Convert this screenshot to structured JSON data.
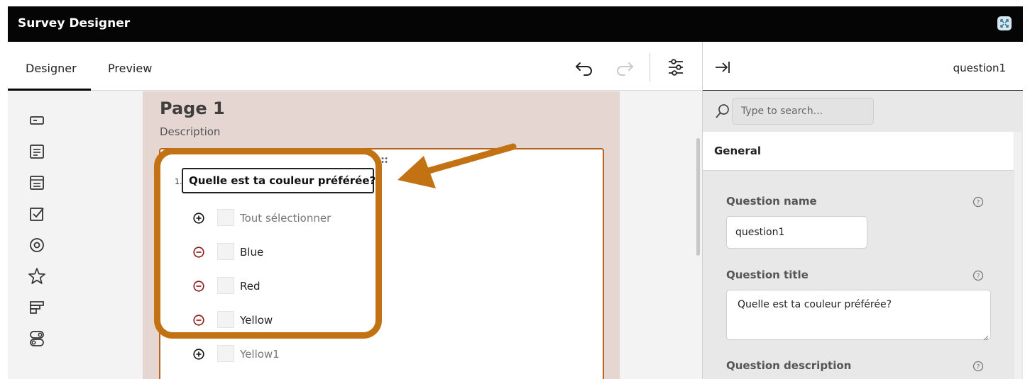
{
  "window": {
    "title": "Survey Designer"
  },
  "tabs": {
    "designer": "Designer",
    "preview": "Preview"
  },
  "toolbox": {
    "items": [
      "single-line-input-icon",
      "long-text-icon",
      "comment-icon",
      "checkbox-icon",
      "radio-icon",
      "star-rating-icon",
      "ranking-icon",
      "boolean-icon"
    ]
  },
  "page": {
    "title": "Page 1",
    "description": "Description"
  },
  "question": {
    "number": "1.",
    "title": "Quelle est ta couleur préférée?",
    "choices": [
      {
        "label": "Tout sélectionner",
        "action": "add",
        "muted": true
      },
      {
        "label": "Blue",
        "action": "remove",
        "muted": false
      },
      {
        "label": "Red",
        "action": "remove",
        "muted": false
      },
      {
        "label": "Yellow",
        "action": "remove",
        "muted": false
      },
      {
        "label": "Yellow1",
        "action": "add",
        "muted": true
      }
    ]
  },
  "panel": {
    "object_name": "question1",
    "search_placeholder": "Type to search...",
    "section": "General",
    "fields": {
      "name_label": "Question name",
      "name_value": "question1",
      "title_label": "Question title",
      "title_value": "Quelle est ta couleur préférée?",
      "description_label": "Question description"
    }
  },
  "colors": {
    "accent": "#c27213",
    "card_border": "#b6631c",
    "remove_icon": "#8b1a1a",
    "canvas_bg": "#e6d6d1",
    "titlebar_bg": "#050505"
  }
}
